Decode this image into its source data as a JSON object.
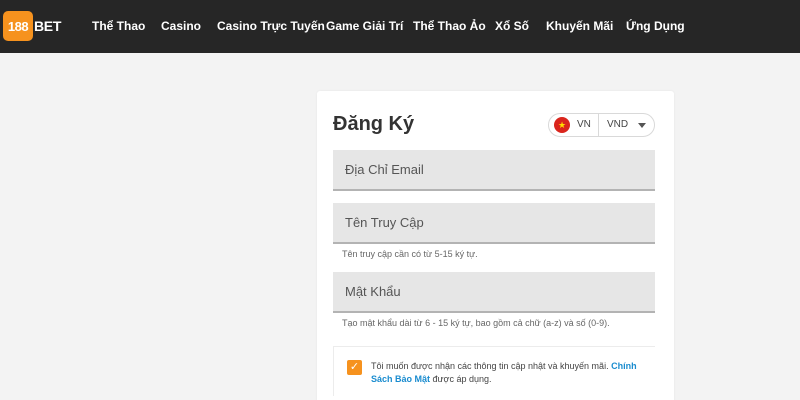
{
  "header": {
    "logo_number": "188",
    "logo_word": "BET",
    "nav": [
      {
        "label": "Thể Thao"
      },
      {
        "label": "Casino"
      },
      {
        "label": "Casino Trực Tuyến"
      },
      {
        "label": "Game Giải Trí"
      },
      {
        "label": "Thể Thao Ảo"
      },
      {
        "label": "Xổ Số"
      },
      {
        "label": "Khuyến Mãi"
      },
      {
        "label": "Ứng Dụng"
      }
    ]
  },
  "form": {
    "title": "Đăng Ký",
    "locale": {
      "country": "VN",
      "currency": "VND",
      "flag_icon": "vietnam-flag-icon"
    },
    "email": {
      "placeholder": "Địa Chỉ Email",
      "value": ""
    },
    "username": {
      "placeholder": "Tên Truy Cập",
      "value": "",
      "hint": "Tên truy cập cần có từ 5-15 ký tự."
    },
    "password": {
      "placeholder": "Mật Khẩu",
      "value": "",
      "hint": "Tạo mật khẩu dài từ 6 - 15 ký tự, bao gồm cả chữ (a-z) và số (0-9)."
    },
    "consent": {
      "checked": true,
      "text_before": "Tôi muốn được nhận các thông tin cập nhật và khuyến mãi.",
      "link": "Chính Sách Bảo Mật",
      "text_after": "được áp dụng."
    }
  },
  "colors": {
    "topbar": "#262626",
    "accent": "#f6921e",
    "link": "#1a8ccf",
    "background": "#f3f3f3"
  }
}
